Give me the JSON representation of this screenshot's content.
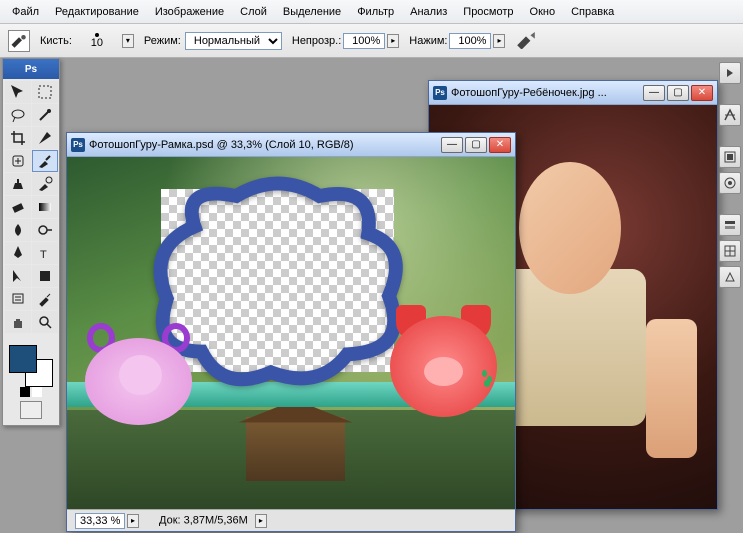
{
  "menu": {
    "items": [
      "Файл",
      "Редактирование",
      "Изображение",
      "Слой",
      "Выделение",
      "Фильтр",
      "Анализ",
      "Просмотр",
      "Окно",
      "Справка"
    ]
  },
  "options": {
    "brush_label": "Кисть:",
    "brush_size": "10",
    "mode_label": "Режим:",
    "mode_value": "Нормальный",
    "opacity_label": "Непрозр.:",
    "opacity_value": "100%",
    "flow_label": "Нажим:",
    "flow_value": "100%"
  },
  "toolbox": {
    "header": "Ps"
  },
  "swatch": {
    "fg": "#1e4f7a",
    "bg": "#ffffff"
  },
  "doc_frame": {
    "title": "ФотошопГуру-Рамка.psd @ 33,3% (Слой 10, RGB/8)",
    "zoom": "33,33 %",
    "docsize_label": "Док:",
    "docsize_value": "3,87M/5,36M"
  },
  "doc_baby": {
    "title": "ФотошопГуру-Ребёночек.jpg ..."
  }
}
